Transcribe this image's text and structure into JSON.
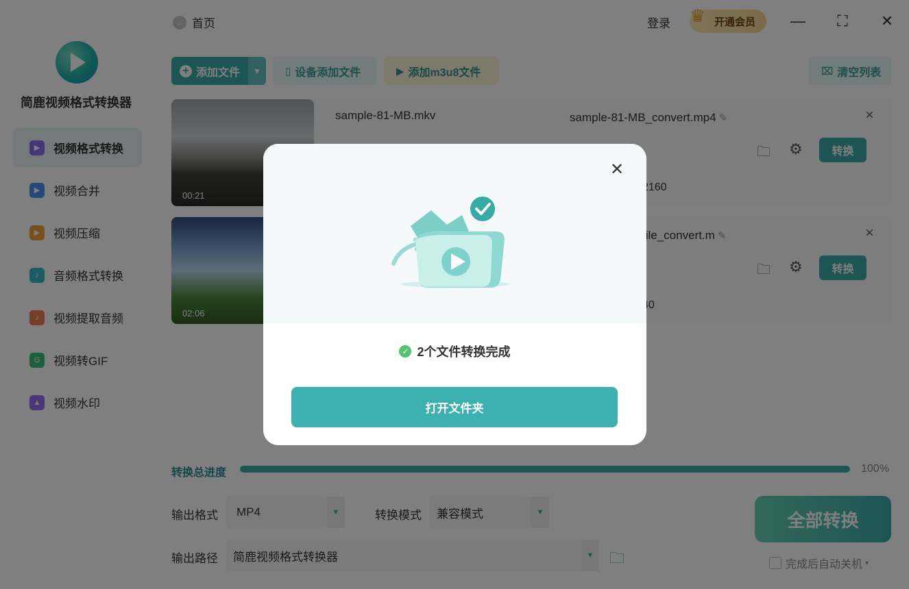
{
  "app": {
    "title": "简鹿视频格式转换器"
  },
  "sidebar": {
    "items": [
      {
        "label": "视频格式转换",
        "icon": "video-convert-icon",
        "color": "#8a6cf0",
        "active": true
      },
      {
        "label": "视频合并",
        "icon": "video-merge-icon",
        "color": "#4d8ef0",
        "active": false
      },
      {
        "label": "视频压缩",
        "icon": "video-compress-icon",
        "color": "#f0a040",
        "active": false
      },
      {
        "label": "音频格式转换",
        "icon": "audio-convert-icon",
        "color": "#35b6c8",
        "active": false
      },
      {
        "label": "视频提取音频",
        "icon": "extract-audio-icon",
        "color": "#f07a50",
        "active": false
      },
      {
        "label": "视频转GIF",
        "icon": "gif-icon",
        "color": "#3bbf7a",
        "active": false
      },
      {
        "label": "视频水印",
        "icon": "watermark-icon",
        "color": "#9a6cf0",
        "active": false
      }
    ]
  },
  "header": {
    "home_label": "首页",
    "login_label": "登录",
    "vip_label": "开通会员",
    "vip_badge": "VIP"
  },
  "toolbar": {
    "add_file": "添加文件",
    "device_add": "设备添加文件",
    "add_m3u8": "添加m3u8文件",
    "clear_list": "清空列表"
  },
  "files": [
    {
      "duration": "00:21",
      "source_name": "sample-81-MB.mkv",
      "output_name": "sample-81-MB_convert.mp4",
      "output_extra": "2160",
      "convert_label": "转换"
    },
    {
      "duration": "02:06",
      "source_name": "",
      "output_name": "file_convert.m",
      "output_extra": "40",
      "convert_label": "转换"
    }
  ],
  "progress": {
    "label": "转换总进度",
    "percent_text": "100%",
    "value": 1.0
  },
  "settings": {
    "output_format_label": "输出格式",
    "output_format_value": "MP4",
    "convert_mode_label": "转换模式",
    "convert_mode_value": "兼容模式",
    "output_path_label": "输出路径",
    "output_path_value": "简鹿视频格式转换器"
  },
  "actions": {
    "convert_all": "全部转换",
    "shutdown_after": "完成后自动关机"
  },
  "modal": {
    "message": "2个文件转换完成",
    "open_folder": "打开文件夹"
  },
  "colors": {
    "accent": "#3aa9a9",
    "success": "#52c46b"
  }
}
